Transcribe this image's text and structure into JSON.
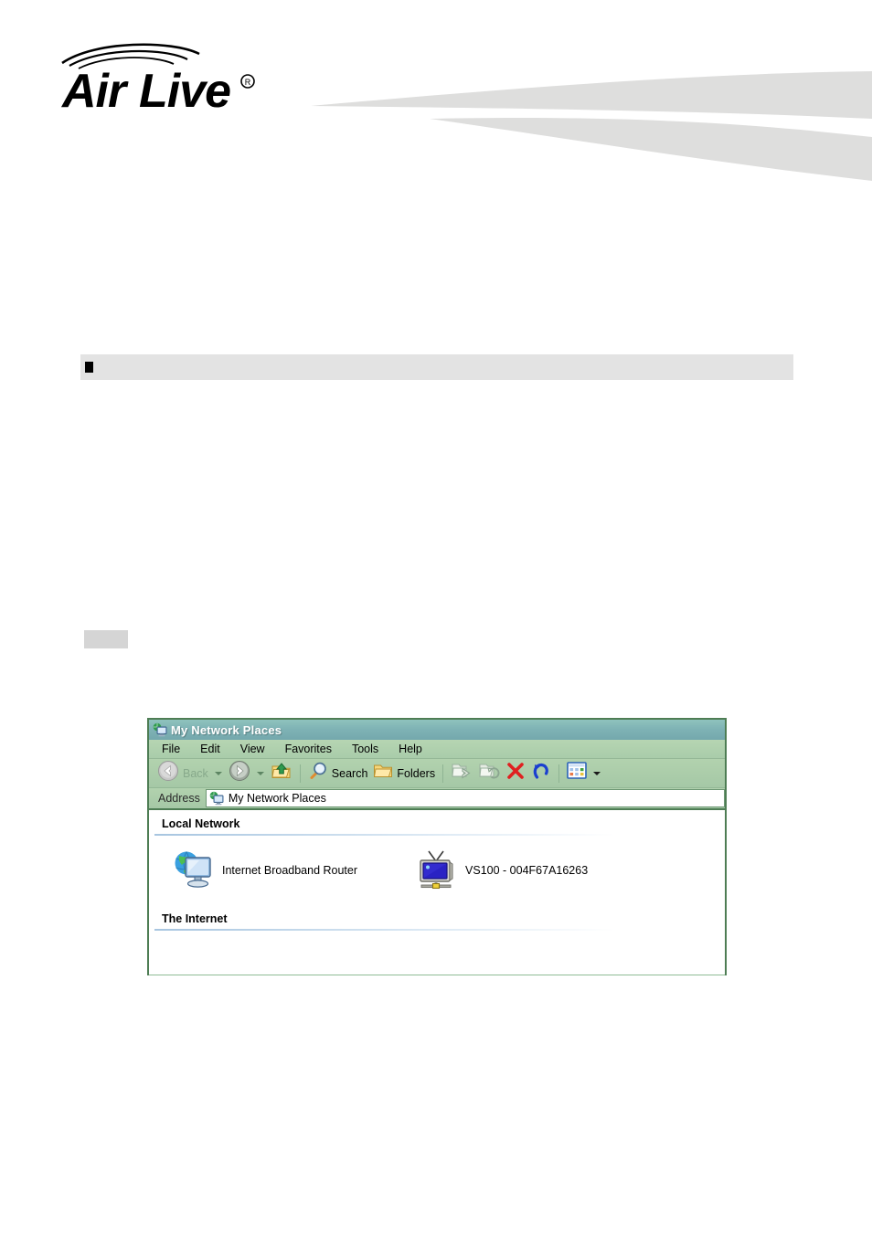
{
  "header": {
    "logo": {
      "name": "AirLive",
      "wordmark_air": "Air",
      "wordmark_live": "Live",
      "registered_mark": "®",
      "arcs_icon": "wireless-arcs-icon"
    },
    "swoosh_color": "#dededd"
  },
  "section": {
    "bullet_icon": "square-bullet-icon",
    "title": "",
    "bar_color": "#e3e3e3"
  },
  "note": {
    "text": "",
    "box_color": "#d5d5d5"
  },
  "explorer": {
    "window_title": "My Network Places",
    "title_icon": "network-places-icon",
    "menu": [
      {
        "label": "File"
      },
      {
        "label": "Edit"
      },
      {
        "label": "View"
      },
      {
        "label": "Favorites"
      },
      {
        "label": "Tools"
      },
      {
        "label": "Help"
      }
    ],
    "toolbar": {
      "back_label": "Back",
      "back_icon": "back-arrow-icon",
      "back_dropdown_icon": "chevron-down-icon",
      "forward_icon": "forward-arrow-icon",
      "forward_dropdown_icon": "chevron-down-icon",
      "up_icon": "up-folder-icon",
      "search_label": "Search",
      "search_icon": "magnifier-icon",
      "folders_label": "Folders",
      "folders_icon": "folder-icon",
      "move_to_icon": "move-to-folder-icon",
      "copy_to_icon": "copy-to-folder-icon",
      "delete_icon": "delete-x-icon",
      "undo_icon": "undo-arrow-icon",
      "views_icon": "views-icon",
      "views_dropdown_icon": "chevron-down-icon"
    },
    "address": {
      "label": "Address",
      "value": "My Network Places",
      "icon": "network-places-icon"
    },
    "content": {
      "groups": [
        {
          "header": "Local Network",
          "items": [
            {
              "label": "Internet Broadband Router",
              "icon": "globe-monitor-icon"
            },
            {
              "label": "VS100 - 004F67A16263",
              "icon": "network-camera-tv-icon"
            }
          ]
        },
        {
          "header": "The Internet",
          "items": []
        }
      ]
    },
    "colors": {
      "title_bar": "#7fb3b5",
      "chrome_green": "#a9cca9",
      "border": "#4e7d54"
    }
  }
}
